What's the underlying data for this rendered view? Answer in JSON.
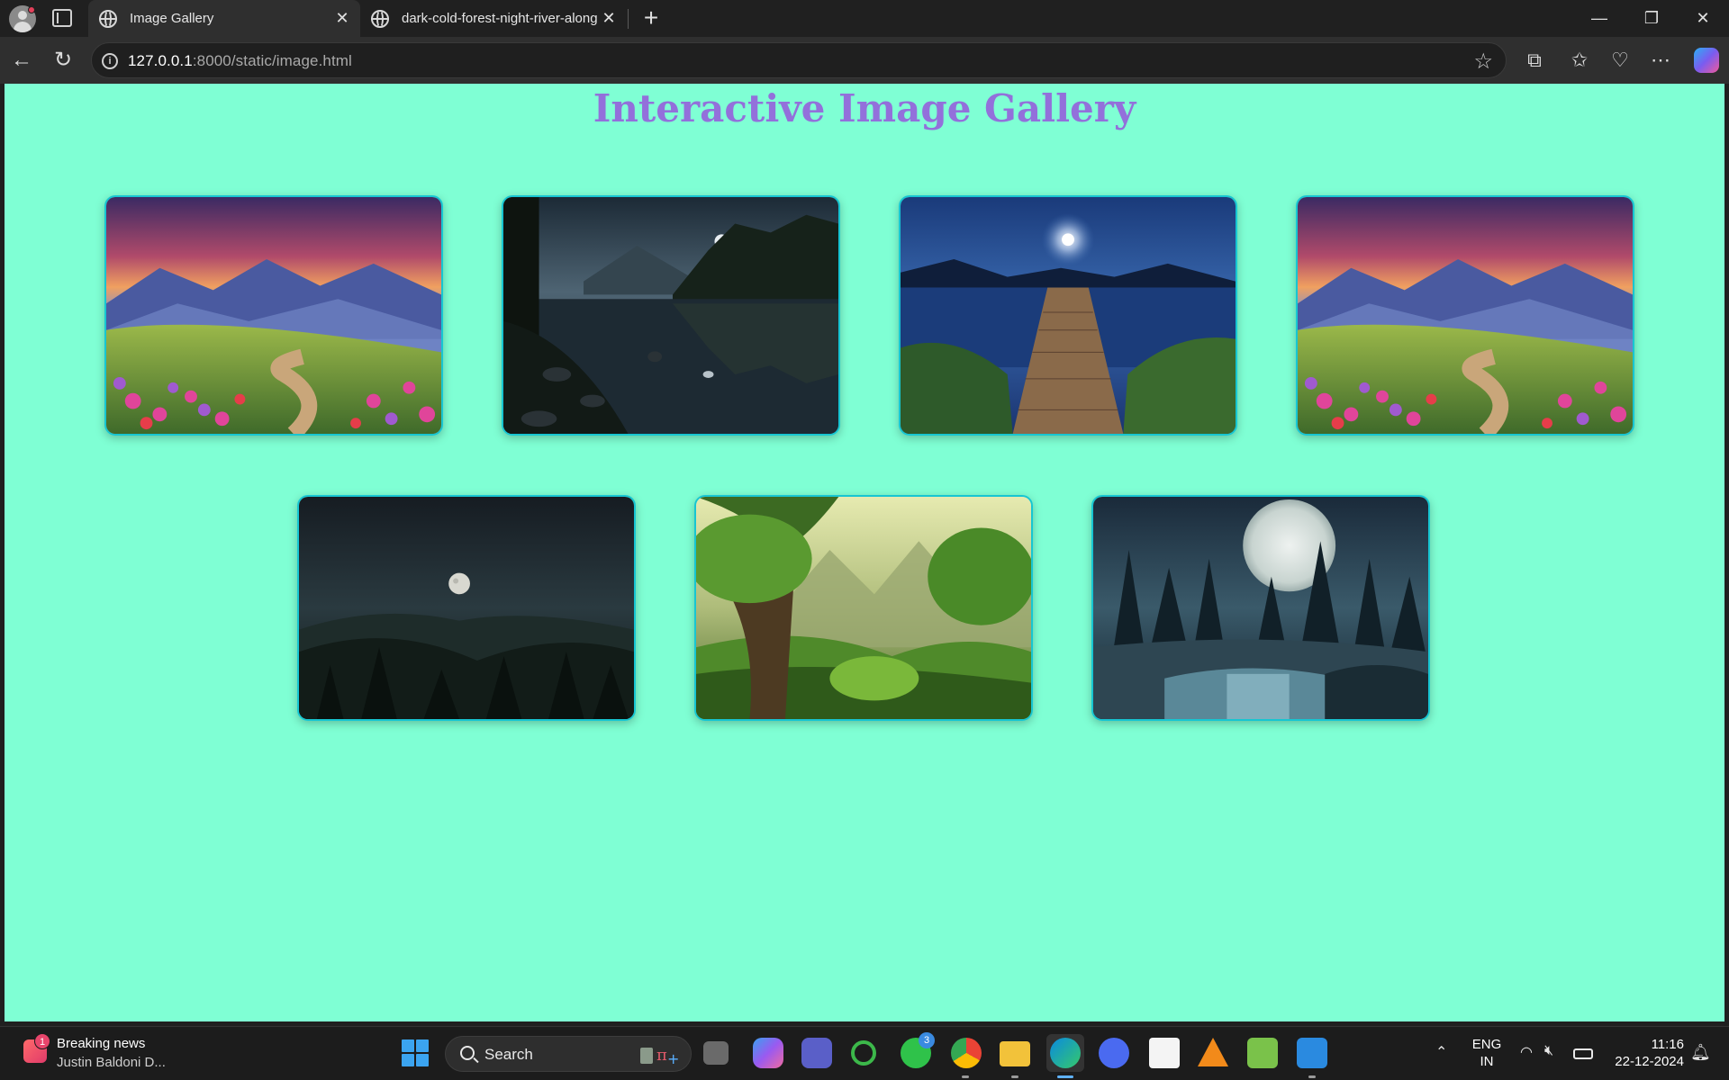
{
  "browser": {
    "tabs": [
      {
        "title": "Image Gallery",
        "active": true
      },
      {
        "title": "dark-cold-forest-night-river-alongside",
        "active": false
      }
    ],
    "address": {
      "host": "127.0.0.1",
      "rest": ":8000/static/image.html"
    },
    "window_controls": {
      "minimize": "—",
      "restore": "❐",
      "close": "✕"
    }
  },
  "page": {
    "title": "Interactive Image Gallery",
    "background_color": "#7fffd4",
    "title_color": "#9370db",
    "images": [
      {
        "name": "flower-meadow-mountains-sunset",
        "alt": ""
      },
      {
        "name": "night-lake-forest-reflection",
        "alt": ""
      },
      {
        "name": "moonlit-lake-wooden-pier",
        "alt": ""
      },
      {
        "name": "flower-meadow-mountains-sunset",
        "alt": ""
      },
      {
        "name": "dark-forest-moon-hills",
        "alt": ""
      },
      {
        "name": "green-forest-misty-mountains",
        "alt": ""
      },
      {
        "name": "full-moon-frozen-forest-river",
        "alt": ""
      }
    ]
  },
  "taskbar": {
    "news": {
      "title": "Breaking news",
      "subtitle": "Justin Baldoni D...",
      "badge": "1"
    },
    "search_label": "Search",
    "whatsapp_badge": "3",
    "language": {
      "line1": "ENG",
      "line2": "IN"
    },
    "clock": {
      "time": "11:16",
      "date": "22-12-2024"
    }
  }
}
